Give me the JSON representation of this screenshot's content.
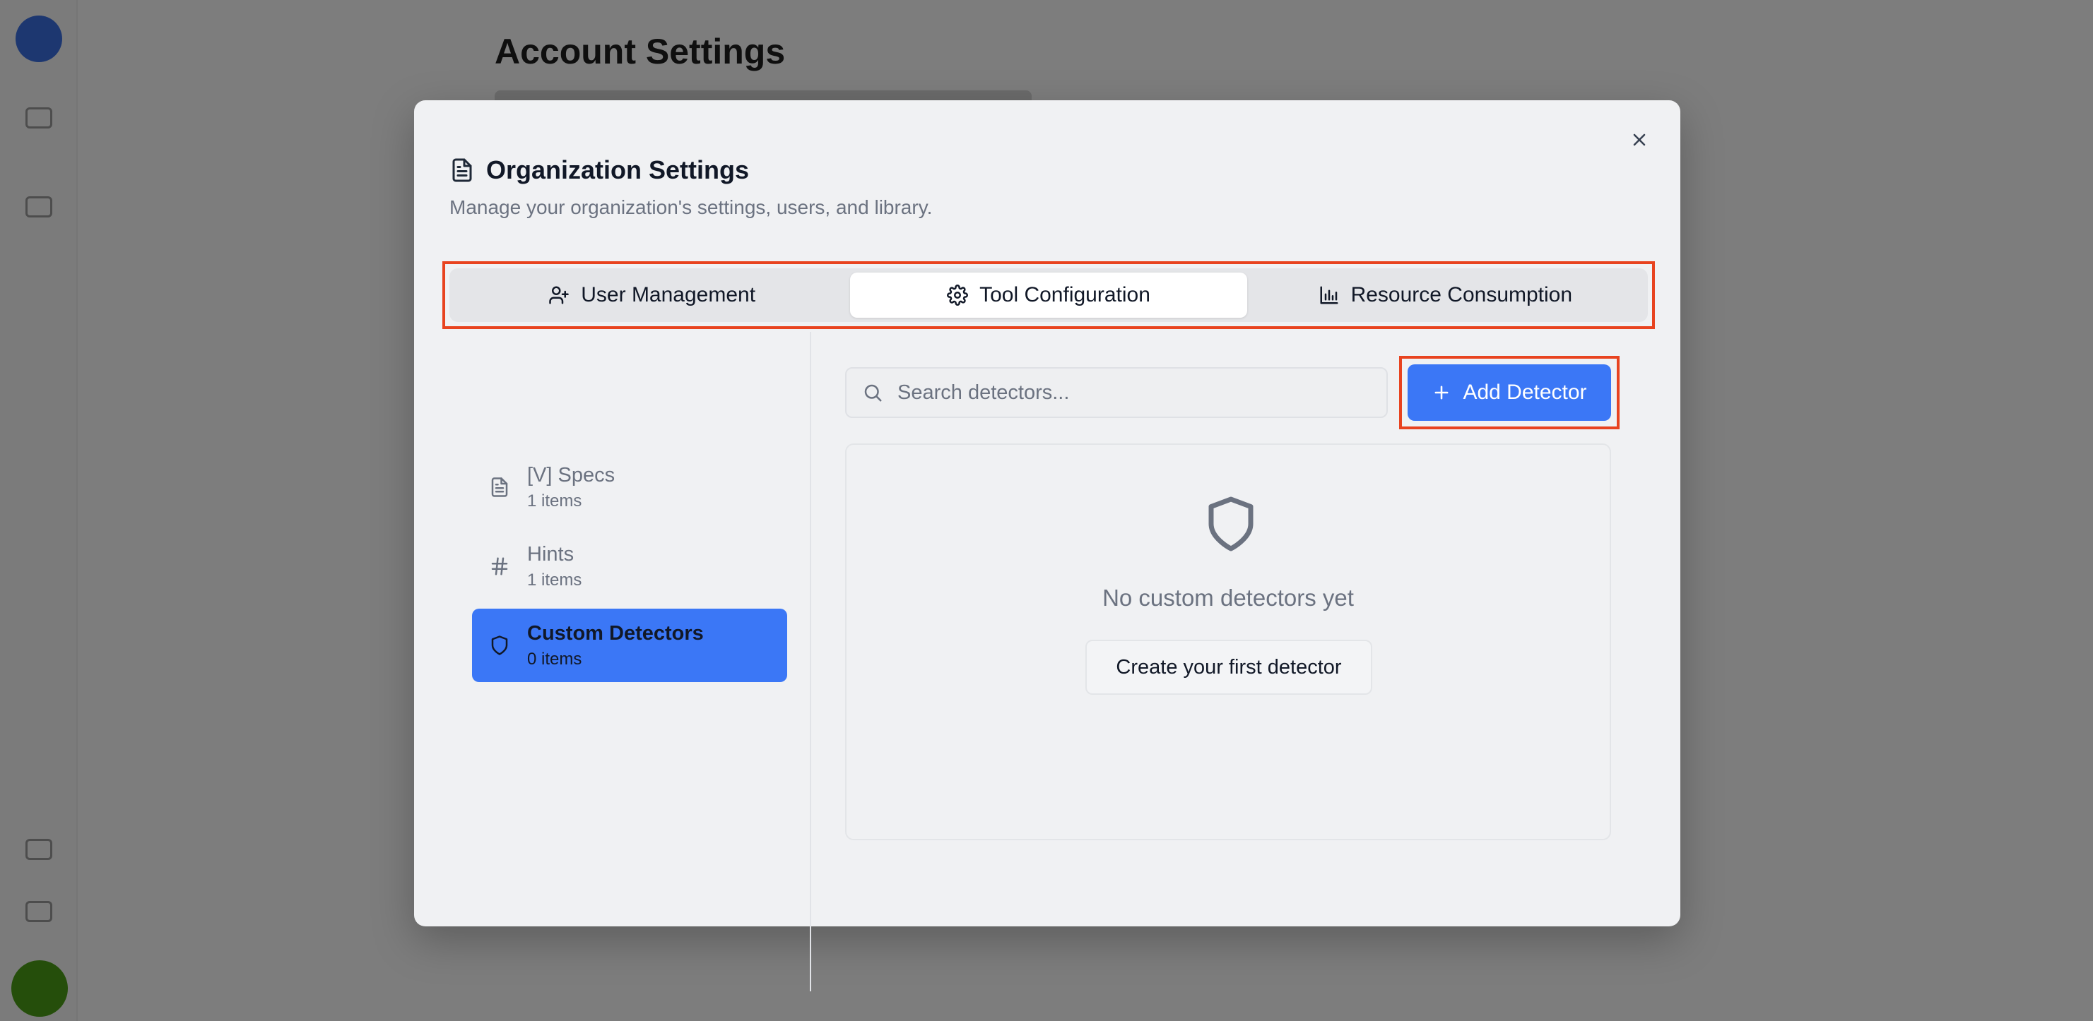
{
  "background": {
    "page_title": "Account Settings"
  },
  "modal": {
    "title": "Organization Settings",
    "subtitle": "Manage your organization's settings, users, and library.",
    "close_icon": "x-icon",
    "title_icon": "document-icon"
  },
  "tabs": [
    {
      "label": "User Management",
      "icon": "user-plus-icon",
      "active": false
    },
    {
      "label": "Tool Configuration",
      "icon": "gear-icon",
      "active": true
    },
    {
      "label": "Resource Consumption",
      "icon": "bar-chart-icon",
      "active": false
    }
  ],
  "sidebar": {
    "items": [
      {
        "label": "[V] Specs",
        "count": "1 items",
        "icon": "document-icon",
        "active": false
      },
      {
        "label": "Hints",
        "count": "1 items",
        "icon": "hash-icon",
        "active": false
      },
      {
        "label": "Custom Detectors",
        "count": "0 items",
        "icon": "shield-icon",
        "active": true
      }
    ]
  },
  "search": {
    "placeholder": "Search detectors...",
    "value": ""
  },
  "add_button": {
    "label": "Add Detector",
    "icon": "plus-icon"
  },
  "empty_state": {
    "icon": "shield-icon",
    "message": "No custom detectors yet",
    "button_label": "Create your first detector"
  },
  "colors": {
    "accent": "#3b77f6",
    "highlight": "#e8431f",
    "overlay": "rgba(0,0,0,0.5)"
  }
}
